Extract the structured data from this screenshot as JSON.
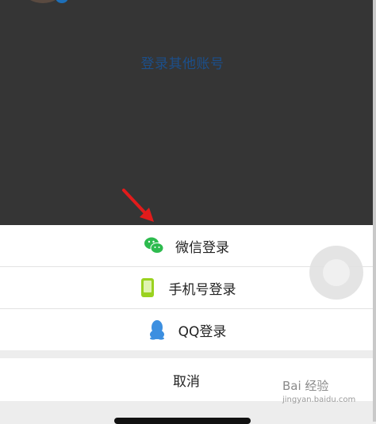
{
  "login_other": {
    "label": "登录其他账号"
  },
  "options": [
    {
      "label": "微信登录",
      "icon": "wechat-icon",
      "icon_color": "#2dbb4e"
    },
    {
      "label": "手机号登录",
      "icon": "phone-icon",
      "icon_color": "#9ad21f"
    },
    {
      "label": "QQ登录",
      "icon": "qq-icon",
      "icon_color": "#3c8fe0"
    }
  ],
  "cancel": {
    "label": "取消"
  },
  "watermark": {
    "brand": "Bai 经验",
    "sub": "jingyan.baidu.com"
  },
  "colors": {
    "overlay": "#353535",
    "link": "#1c4f8a",
    "arrow": "#e11b1b"
  }
}
